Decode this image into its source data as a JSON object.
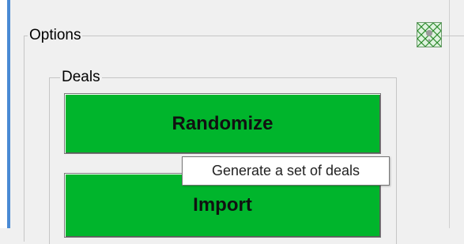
{
  "options_group": {
    "label": "Options"
  },
  "deals_group": {
    "label": "Deals"
  },
  "buttons": {
    "randomize": "Randomize",
    "import": "Import"
  },
  "tooltip": {
    "text": "Generate a set of deals"
  },
  "icon": {
    "name": "green-grid-icon"
  },
  "colors": {
    "button_green": "#00b52c",
    "accent_blue": "#4a8ad4"
  }
}
